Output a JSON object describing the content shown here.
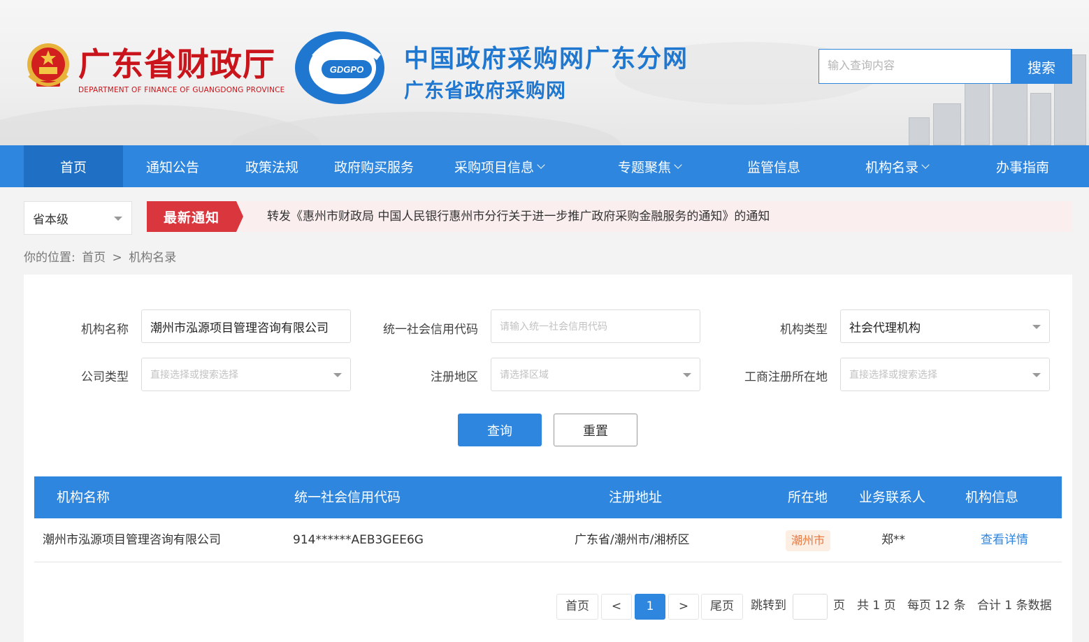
{
  "header": {
    "dept_name": "广东省财政厅",
    "dept_name_en": "DEPARTMENT OF FINANCE OF GUANGDONG PROVINCE",
    "logo_text": "GDGPO",
    "site_title": "中国政府采购网广东分网",
    "site_subtitle": "广东省政府采购网",
    "search_placeholder": "输入查询内容",
    "search_button": "搜索"
  },
  "nav": {
    "items": [
      {
        "label": "首页"
      },
      {
        "label": "通知公告"
      },
      {
        "label": "政策法规"
      },
      {
        "label": "政府购买服务"
      },
      {
        "label": "采购项目信息"
      },
      {
        "label": "专题聚焦"
      },
      {
        "label": "监管信息"
      },
      {
        "label": "机构名录"
      },
      {
        "label": "办事指南"
      }
    ]
  },
  "level_select": {
    "value": "省本级"
  },
  "notice": {
    "badge": "最新通知",
    "text": "转发《惠州市财政局 中国人民银行惠州市分行关于进一步推广政府采购金融服务的通知》的通知"
  },
  "breadcrumb": {
    "prefix": "你的位置:",
    "home": "首页",
    "sep": ">",
    "current": "机构名录"
  },
  "form": {
    "org_name_label": "机构名称",
    "org_name_value": "潮州市泓源项目管理咨询有限公司",
    "credit_code_label": "统一社会信用代码",
    "credit_code_placeholder": "请输入统一社会信用代码",
    "org_type_label": "机构类型",
    "org_type_value": "社会代理机构",
    "company_type_label": "公司类型",
    "company_type_placeholder": "直接选择或搜索选择",
    "region_label": "注册地区",
    "region_placeholder": "请选择区域",
    "biz_reg_label": "工商注册所在地",
    "biz_reg_placeholder": "直接选择或搜索选择",
    "query_button": "查询",
    "reset_button": "重置"
  },
  "table": {
    "headers": [
      "机构名称",
      "统一社会信用代码",
      "注册地址",
      "所在地",
      "业务联系人",
      "机构信息"
    ],
    "rows": [
      {
        "name": "潮州市泓源项目管理咨询有限公司",
        "credit_code": "914******AEB3GEE6G",
        "address": "广东省/潮州市/湘桥区",
        "city": "潮州市",
        "contact": "郑**",
        "action": "查看详情"
      }
    ]
  },
  "pagination": {
    "first": "首页",
    "prev": "<",
    "current": "1",
    "next": ">",
    "last": "尾页",
    "goto_label": "跳转到",
    "page_unit": "页",
    "total_pages": "共 1 页",
    "per_page": "每页 12 条",
    "total_records": "合计 1 条数据"
  },
  "colors": {
    "primary": "#2e86de",
    "nav_active": "#1f6fc4",
    "brand_red": "#c8141a",
    "notice_red": "#d9363e",
    "tag_orange": "#e8763a"
  }
}
